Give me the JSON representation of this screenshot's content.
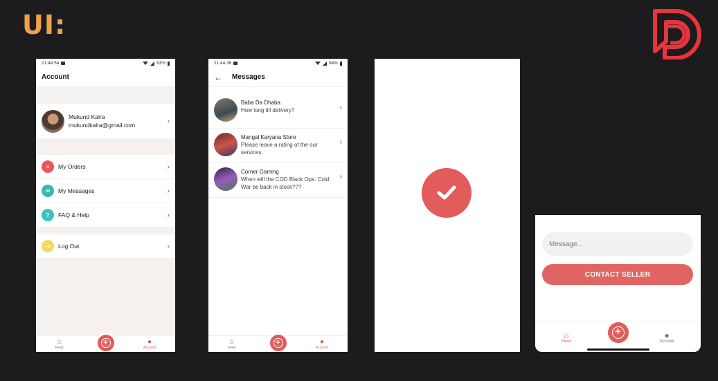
{
  "brand": {
    "label": "UI:",
    "logo_color": "#e8343c"
  },
  "colors": {
    "accent": "#e25c5c",
    "background": "#1c1c1e",
    "brand_orange": "#f0a04b"
  },
  "account_screen": {
    "status": {
      "time": "21:44:54",
      "battery": "93%"
    },
    "title": "Account",
    "profile": {
      "name": "Mukund Kalra",
      "email": "mukundkalra@gmail.com"
    },
    "menu": [
      {
        "label": "My Orders",
        "icon": "list-icon",
        "color": "#e8565f"
      },
      {
        "label": "My Messages",
        "icon": "mail-icon",
        "color": "#39b8b0"
      },
      {
        "label": "FAQ & Help",
        "icon": "help-icon",
        "color": "#3cc4b9"
      }
    ],
    "logout": {
      "label": "Log Out",
      "icon": "logout-icon",
      "color": "#f3d95e"
    },
    "nav": {
      "feed": "Feed",
      "account": "Account"
    }
  },
  "messages_screen": {
    "status": {
      "time": "21:44:36",
      "battery": "94%"
    },
    "title": "Messages",
    "messages": [
      {
        "name": "Baba Da Dhaba",
        "preview": "How long till delivery?"
      },
      {
        "name": "Mangal Karyana Store",
        "preview": "Please leave a rating of the our services."
      },
      {
        "name": "Corner Gaming",
        "preview": "When will the COD Black Ops: Cold War be back in stock???"
      }
    ],
    "nav": {
      "feed": "Feed",
      "account": "Account"
    }
  },
  "success_screen": {
    "icon": "check-icon"
  },
  "contact_screen": {
    "message_placeholder": "Message...",
    "button_label": "CONTACT SELLER",
    "nav": {
      "feed": "Feed",
      "account": "Account"
    }
  }
}
